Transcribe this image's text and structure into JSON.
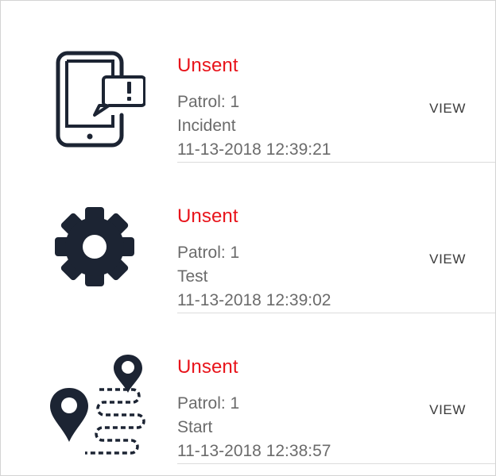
{
  "colors": {
    "status_unsent": "#e8141b",
    "icon": "#1c2433",
    "meta_text": "#6b6b6b",
    "action_text": "#3a3a3a"
  },
  "entries": [
    {
      "icon": "mobile-incident-icon",
      "status": "Unsent",
      "patrol": "Patrol: 1",
      "type": "Incident",
      "timestamp": "11-13-2018 12:39:21",
      "action": "VIEW"
    },
    {
      "icon": "gear-icon",
      "status": "Unsent",
      "patrol": "Patrol: 1",
      "type": "Test",
      "timestamp": "11-13-2018 12:39:02",
      "action": "VIEW"
    },
    {
      "icon": "route-pins-icon",
      "status": "Unsent",
      "patrol": "Patrol: 1",
      "type": "Start",
      "timestamp": "11-13-2018 12:38:57",
      "action": "VIEW"
    }
  ]
}
